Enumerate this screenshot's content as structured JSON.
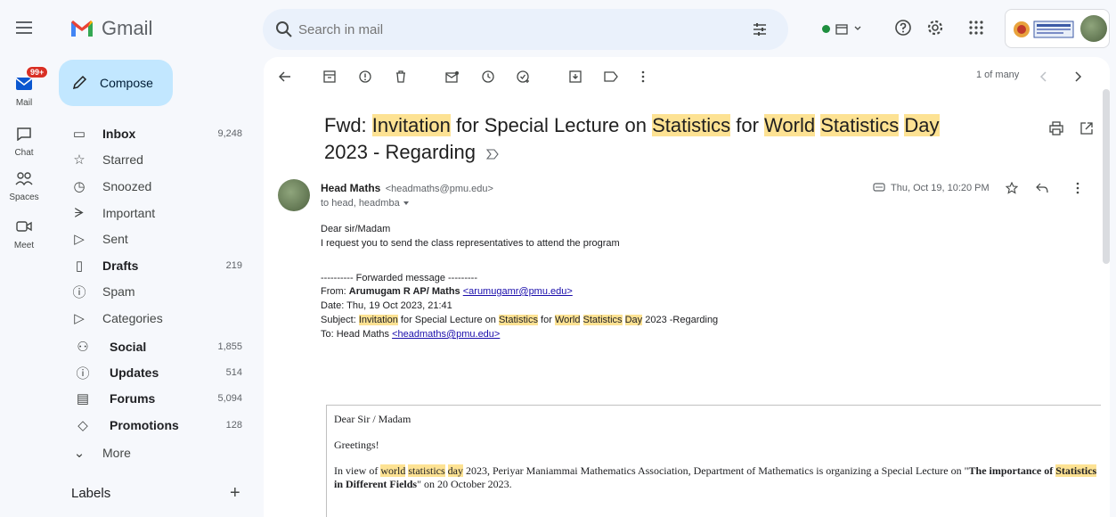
{
  "app": {
    "name": "Gmail"
  },
  "search": {
    "placeholder": "Search in mail"
  },
  "rail": {
    "mail_badge": "99+",
    "items": [
      {
        "label": "Mail",
        "icon": "mail-icon"
      },
      {
        "label": "Chat",
        "icon": "chat-icon"
      },
      {
        "label": "Spaces",
        "icon": "spaces-icon"
      },
      {
        "label": "Meet",
        "icon": "meet-icon"
      }
    ]
  },
  "compose": {
    "label": "Compose"
  },
  "nav": [
    {
      "label": "Inbox",
      "count": "9,248",
      "bold": true,
      "icon": "inbox-icon"
    },
    {
      "label": "Starred",
      "count": "",
      "bold": false,
      "icon": "star-icon"
    },
    {
      "label": "Snoozed",
      "count": "",
      "bold": false,
      "icon": "clock-icon"
    },
    {
      "label": "Important",
      "count": "",
      "bold": false,
      "icon": "important-icon"
    },
    {
      "label": "Sent",
      "count": "",
      "bold": false,
      "icon": "send-icon"
    },
    {
      "label": "Drafts",
      "count": "219",
      "bold": true,
      "icon": "draft-icon"
    },
    {
      "label": "Spam",
      "count": "",
      "bold": false,
      "icon": "spam-icon"
    },
    {
      "label": "Categories",
      "count": "",
      "bold": false,
      "icon": "label-icon"
    },
    {
      "label": "Social",
      "count": "1,855",
      "bold": true,
      "icon": "people-icon"
    },
    {
      "label": "Updates",
      "count": "514",
      "bold": true,
      "icon": "info-icon"
    },
    {
      "label": "Forums",
      "count": "5,094",
      "bold": true,
      "icon": "forum-icon"
    },
    {
      "label": "Promotions",
      "count": "128",
      "bold": true,
      "icon": "tag-icon"
    },
    {
      "label": "More",
      "count": "",
      "bold": false,
      "icon": "chevron-down-icon"
    }
  ],
  "labels": {
    "title": "Labels",
    "add": "+"
  },
  "pager": {
    "text": "1 of many"
  },
  "email": {
    "subject_parts": [
      {
        "text": "Fwd: ",
        "hl": false
      },
      {
        "text": "Invitation",
        "hl": true
      },
      {
        "text": " for Special Lecture on ",
        "hl": false
      },
      {
        "text": "Statistics",
        "hl": true
      },
      {
        "text": " for ",
        "hl": false
      },
      {
        "text": "World",
        "hl": true
      },
      {
        "text": " ",
        "hl": false
      },
      {
        "text": "Statistics",
        "hl": true
      },
      {
        "text": " ",
        "hl": false
      },
      {
        "text": "Day",
        "hl": true
      },
      {
        "text": " 2023 - Regarding",
        "hl": false
      }
    ],
    "sender_name": "Head Maths",
    "sender_email": "<headmaths@pmu.edu>",
    "to": "to head, headmba",
    "date": "Thu, Oct 19, 10:20 PM",
    "greeting": "Dear sir/Madam",
    "request": "I request you to send the class representatives to attend the program",
    "fwd_header": "---------- Forwarded message ---------",
    "from_label": "From: ",
    "from_name": "Arumugam R AP/ Maths ",
    "from_email": "<arumugamr@pmu.edu>",
    "date_line": "Date: Thu, 19 Oct 2023, 21:41",
    "subject_line_parts": [
      {
        "text": "Subject: ",
        "hl": false
      },
      {
        "text": "Invitation",
        "hl": true
      },
      {
        "text": " for Special Lecture on ",
        "hl": false
      },
      {
        "text": "Statistics",
        "hl": true
      },
      {
        "text": " for ",
        "hl": false
      },
      {
        "text": "World",
        "hl": true
      },
      {
        "text": " ",
        "hl": false
      },
      {
        "text": "Statistics",
        "hl": true
      },
      {
        "text": " ",
        "hl": false
      },
      {
        "text": "Day",
        "hl": true
      },
      {
        "text": " 2023 -Regarding",
        "hl": false
      }
    ],
    "to_line_label": "To: Head Maths ",
    "to_line_email": "<headmaths@pmu.edu>",
    "quoted": {
      "greeting": "Dear Sir / Madam",
      "greetings": "Greetings!",
      "paragraph_parts": [
        {
          "text": "In view of ",
          "hl": false,
          "bold": false
        },
        {
          "text": "world",
          "hl": true,
          "bold": false
        },
        {
          "text": " ",
          "hl": false,
          "bold": false
        },
        {
          "text": "statistics",
          "hl": true,
          "bold": false
        },
        {
          "text": " ",
          "hl": false,
          "bold": false
        },
        {
          "text": "day",
          "hl": true,
          "bold": false
        },
        {
          "text": " 2023, Periyar Maniammai Mathematics Association, Department of Mathematics is organizing a Special Lecture on \"",
          "hl": false,
          "bold": false
        },
        {
          "text": "The importance of ",
          "hl": false,
          "bold": true
        },
        {
          "text": "Statistics",
          "hl": true,
          "bold": true
        },
        {
          "text": " in Different Fields",
          "hl": false,
          "bold": true
        },
        {
          "text": "\" on 20 October 2023.",
          "hl": false,
          "bold": false
        }
      ]
    }
  },
  "colors": {
    "accent": "#c2e7ff",
    "highlight": "#fde293",
    "background": "#f6f8fc"
  }
}
